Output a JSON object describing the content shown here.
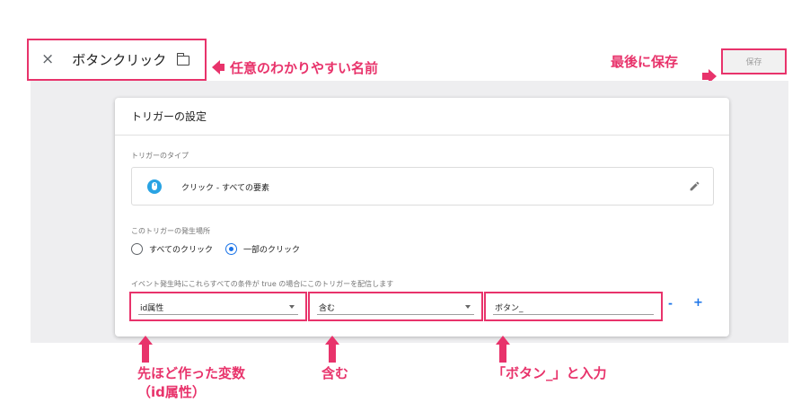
{
  "header": {
    "close_label": "×",
    "title": "ボタンクリック",
    "save_label": "保存"
  },
  "annotations": {
    "name_hint": "任意のわかりやすい名前",
    "save_hint": "最後に保存",
    "variable_hint_line1": "先ほど作った変数",
    "variable_hint_line2": "（id属性）",
    "contains_hint": "含む",
    "value_hint": "「ボタン_」と入力"
  },
  "trigger_card": {
    "title": "トリガーの設定",
    "type_label": "トリガーのタイプ",
    "type_value": "クリック - すべての要素",
    "fire_on_label": "このトリガーの発生場所",
    "fire_on_options": [
      "すべてのクリック",
      "一部のクリック"
    ],
    "fire_on_selected": "一部のクリック",
    "condition_label": "イベント発生時にこれらすべての条件が true の場合にこのトリガーを配信します",
    "condition": {
      "variable": "id属性",
      "operator": "含む",
      "value": "ボタン_"
    },
    "remove_label": "-",
    "add_label": "+"
  },
  "icons": {
    "close": "close-icon",
    "folder": "folder-icon",
    "mouse": "mouse-icon",
    "edit": "pencil-icon"
  },
  "colors": {
    "highlight": "#e8336b",
    "accent": "#1a73e8",
    "mouse_icon": "#29a3e3"
  }
}
